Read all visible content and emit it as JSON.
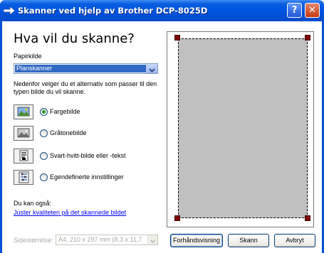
{
  "window": {
    "title": "Skanner ved hjelp av Brother  DCP-8025D",
    "help_label": "?",
    "close_label": "✕"
  },
  "heading": "Hva vil du skanne?",
  "paper_source": {
    "label": "Papirkilde",
    "value": "Planskanner"
  },
  "description": "Nedenfor velger du et alternativ som passer til den typen bilde du vil skanne.",
  "options": [
    {
      "label": "Fargebilde",
      "checked": true,
      "icon": "color-picture-icon"
    },
    {
      "label": "Gråtonebilde",
      "checked": false,
      "icon": "grayscale-picture-icon"
    },
    {
      "label": "Svart-hvitt-bilde eller -tekst",
      "checked": false,
      "icon": "bw-text-icon"
    },
    {
      "label": "Egendefinerte innstillinger",
      "checked": false,
      "icon": "custom-settings-icon"
    }
  ],
  "also": {
    "label": "Du kan også:",
    "link": "Juster kvaliteten på det skannede bildet"
  },
  "page_size": {
    "label": "Sidestørrelse:",
    "value": "A4, 210 x 297 mm (8,3 x 11,7"
  },
  "buttons": {
    "preview": "Forhåndsvisning",
    "scan": "Skann",
    "cancel": "Avbryt"
  },
  "colors": {
    "titlebar": "#0054e3",
    "selection": "#316ac5",
    "link": "#0000ff",
    "scan_area": "#c0c0c0",
    "handle": "#800000"
  }
}
